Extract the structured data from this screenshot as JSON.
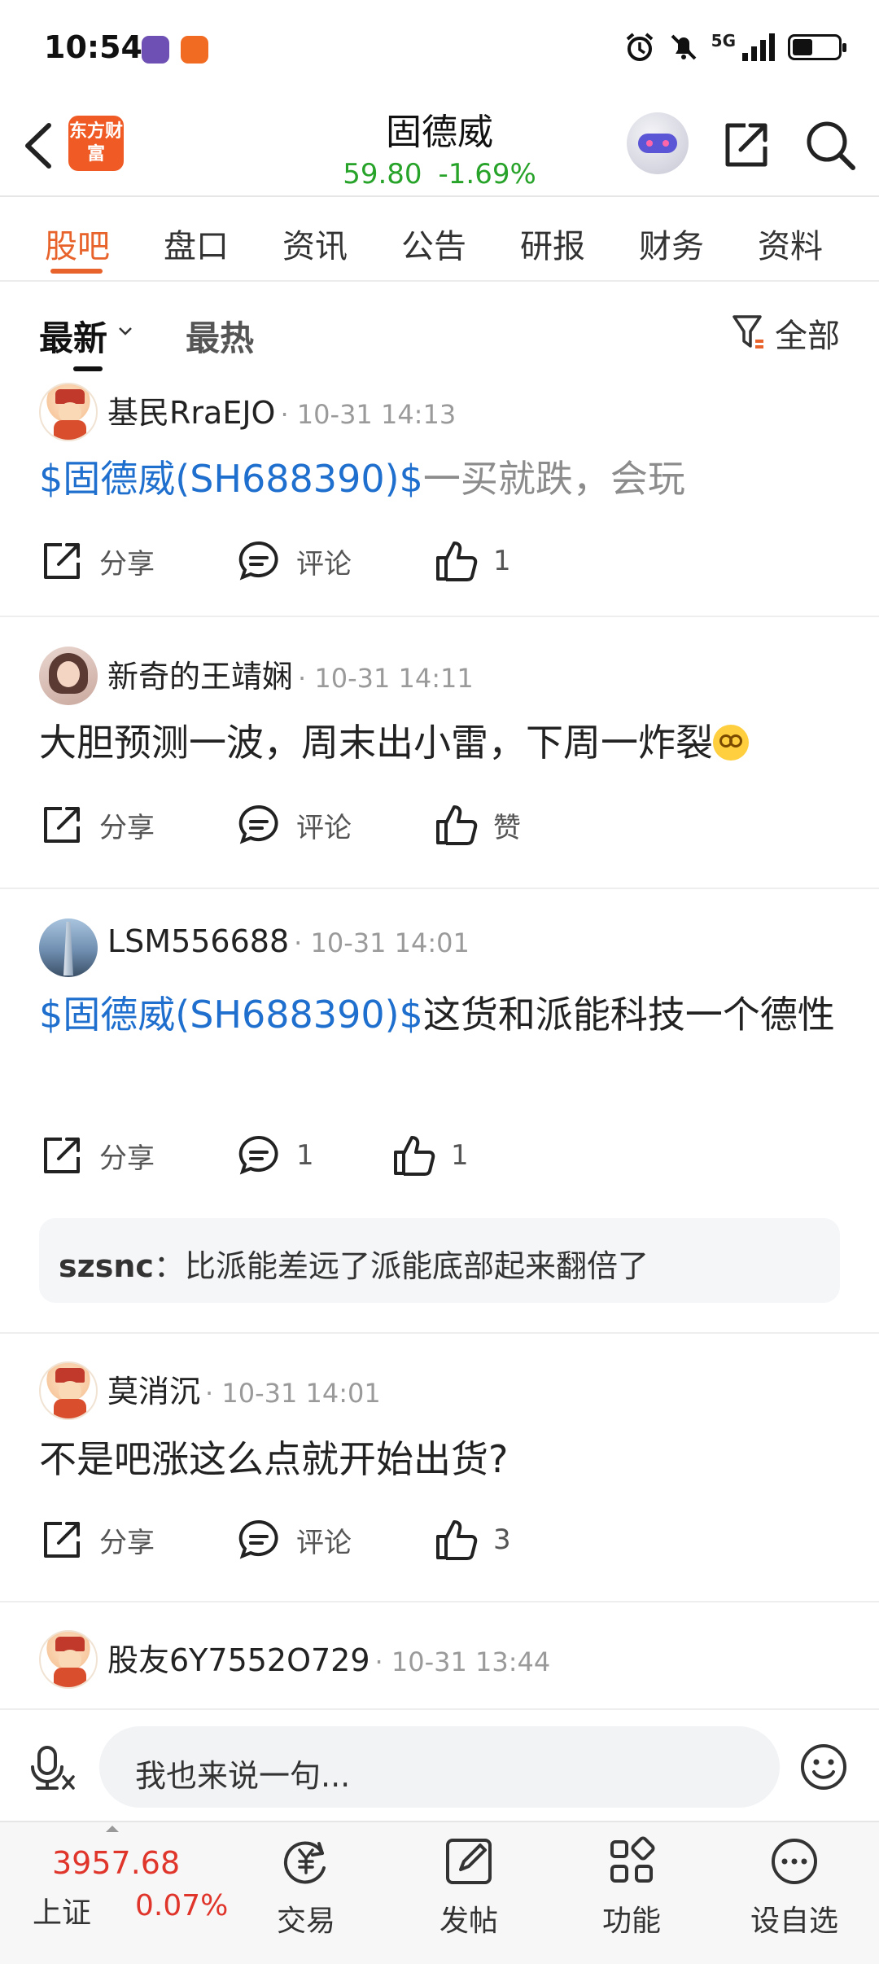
{
  "status_bar": {
    "time": "10:54",
    "network": "5G"
  },
  "header": {
    "brand": "东方财富",
    "title": "固德威",
    "price": "59.80",
    "change": "-1.69%"
  },
  "tabs": [
    {
      "label": "股吧",
      "active": true
    },
    {
      "label": "盘口"
    },
    {
      "label": "资讯"
    },
    {
      "label": "公告"
    },
    {
      "label": "研报"
    },
    {
      "label": "财务"
    },
    {
      "label": "资料"
    }
  ],
  "sort": {
    "latest": "最新",
    "hot": "最热",
    "filter": "全部"
  },
  "posts": [
    {
      "user": "基民RraEJO",
      "time": "· 10-31 14:13",
      "stock_tag": "$固德威(SH688390)$",
      "text": "一买就跌，会玩",
      "share": "分享",
      "comment": "评论",
      "likes": "1"
    },
    {
      "user": "新奇的王靖娴",
      "time": "· 10-31 14:11",
      "text": "大胆预测一波，周末出小雷，下周一炸裂",
      "share": "分享",
      "comment": "评论",
      "likes": "赞"
    },
    {
      "user": "LSM556688",
      "time": "· 10-31 14:01",
      "stock_tag": "$固德威(SH688390)$",
      "text": "这货和派能科技一个德性",
      "share": "分享",
      "comment": "1",
      "likes": "1",
      "reply": {
        "user": "szsnc",
        "text": "：比派能差远了派能底部起来翻倍了"
      }
    },
    {
      "user": "莫消沉",
      "time": "· 10-31 14:01",
      "text": "不是吧涨这么点就开始出货?",
      "share": "分享",
      "comment": "评论",
      "likes": "3"
    },
    {
      "user": "股友6Y7552O729",
      "time": "· 10-31 13:44"
    }
  ],
  "input": {
    "placeholder": "我也来说一句..."
  },
  "bottom_nav": {
    "index_value": "3957.68",
    "index_name": "上证",
    "index_change": "0.07%",
    "items": [
      "交易",
      "发帖",
      "功能",
      "设自选"
    ]
  },
  "colors": {
    "accent": "#e8632b",
    "price_down": "#27a32a",
    "price_up": "#e0352b",
    "link": "#1f6fce"
  }
}
